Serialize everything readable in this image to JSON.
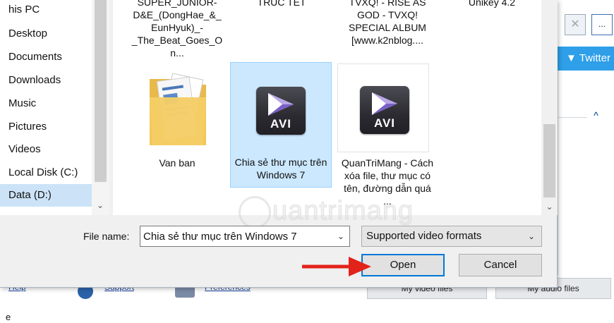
{
  "nav": {
    "items": [
      {
        "label": "his PC"
      },
      {
        "label": "Desktop"
      },
      {
        "label": "Documents"
      },
      {
        "label": "Downloads"
      },
      {
        "label": "Music"
      },
      {
        "label": "Pictures"
      },
      {
        "label": "Videos"
      },
      {
        "label": "Local Disk (C:)"
      },
      {
        "label": "Data (D:)",
        "selected": true
      }
    ]
  },
  "files": {
    "top_row": [
      {
        "name": "SUPER_JUNIOR-D&E_(DongHae_&_EunHyuk)_-_The_Beat_Goes_On..."
      },
      {
        "name": "TRUC TET"
      },
      {
        "name": "TVXQ! - RISE AS GOD - TVXQ! SPECIAL ALBUM [www.k2nblog...."
      },
      {
        "name": "Unikey 4.2"
      }
    ],
    "items": [
      {
        "name": "Van ban",
        "icon": "folder-icon"
      },
      {
        "name": "Chia sẻ thư mục trên Windows 7",
        "icon": "avi-video-icon",
        "selected": true,
        "badge": "AVI"
      },
      {
        "name": "QuanTriMang - Cách xóa file, thư mục có tên, đường dẫn quá ...",
        "icon": "avi-video-icon",
        "badge": "AVI"
      }
    ]
  },
  "bottom": {
    "filename_label": "File name:",
    "filename_value": "Chia sẻ thư mục trên Windows 7",
    "filter_value": "Supported video formats",
    "open_label": "Open",
    "cancel_label": "Cancel"
  },
  "background": {
    "twitter_label": "Twitter",
    "more_button": "...",
    "video_button": "My video files",
    "audio_button": "My audio files",
    "links": [
      "Help",
      "Support",
      "Preferences"
    ],
    "footer_char": "e"
  },
  "watermark": {
    "text": "uantrimang"
  },
  "colors": {
    "selection": "#cce8ff",
    "open_border": "#0078d7",
    "arrow": "#e2231a",
    "twitter": "#2e9fe8"
  }
}
